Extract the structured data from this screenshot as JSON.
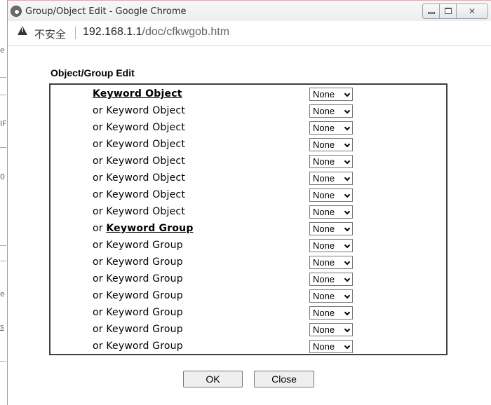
{
  "background_page": {
    "edge_chars": [
      "e",
      "IF",
      "0",
      "e",
      "s"
    ]
  },
  "window": {
    "title": "Group/Object Edit - Google Chrome",
    "controls": {
      "minimize": "minimize",
      "maximize": "maximize",
      "close": "close"
    }
  },
  "address_bar": {
    "security_label": "不安全",
    "url_host": "192.168.1.1",
    "url_path": "/doc/cfkwgob.htm"
  },
  "form": {
    "title": "Object/Group Edit",
    "rows": [
      {
        "prefix": "",
        "label": "Keyword Object",
        "emphasis": true,
        "value": "None"
      },
      {
        "prefix": "",
        "label": "or Keyword Object",
        "emphasis": false,
        "value": "None"
      },
      {
        "prefix": "",
        "label": "or Keyword Object",
        "emphasis": false,
        "value": "None"
      },
      {
        "prefix": "",
        "label": "or Keyword Object",
        "emphasis": false,
        "value": "None"
      },
      {
        "prefix": "",
        "label": "or Keyword Object",
        "emphasis": false,
        "value": "None"
      },
      {
        "prefix": "",
        "label": "or Keyword Object",
        "emphasis": false,
        "value": "None"
      },
      {
        "prefix": "",
        "label": "or Keyword Object",
        "emphasis": false,
        "value": "None"
      },
      {
        "prefix": "",
        "label": "or Keyword Object",
        "emphasis": false,
        "value": "None"
      },
      {
        "prefix": "or ",
        "label": "Keyword Group",
        "emphasis": true,
        "value": "None"
      },
      {
        "prefix": "",
        "label": "or Keyword Group",
        "emphasis": false,
        "value": "None"
      },
      {
        "prefix": "",
        "label": "or Keyword Group",
        "emphasis": false,
        "value": "None"
      },
      {
        "prefix": "",
        "label": "or Keyword Group",
        "emphasis": false,
        "value": "None"
      },
      {
        "prefix": "",
        "label": "or Keyword Group",
        "emphasis": false,
        "value": "None"
      },
      {
        "prefix": "",
        "label": "or Keyword Group",
        "emphasis": false,
        "value": "None"
      },
      {
        "prefix": "",
        "label": "or Keyword Group",
        "emphasis": false,
        "value": "None"
      },
      {
        "prefix": "",
        "label": "or Keyword Group",
        "emphasis": false,
        "value": "None"
      }
    ]
  },
  "buttons": {
    "ok_label": "OK",
    "close_label": "Close"
  }
}
